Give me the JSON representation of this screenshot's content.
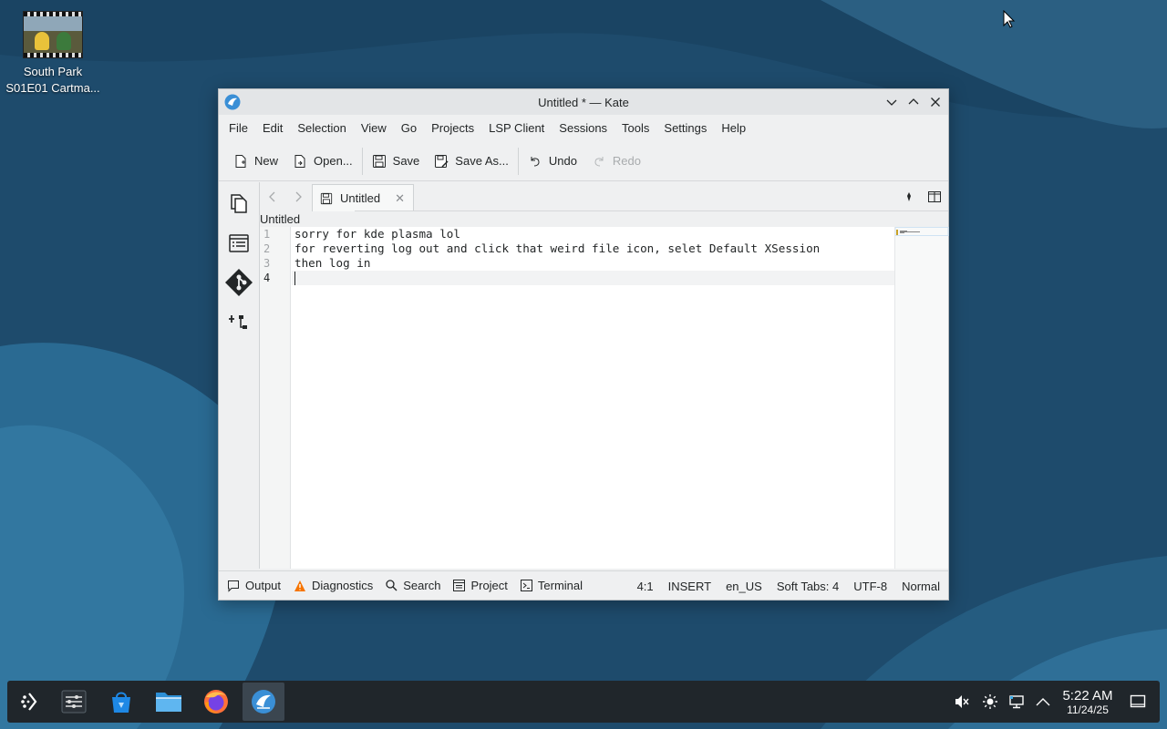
{
  "desktop": {
    "icon_label_line1": "South Park",
    "icon_label_line2": "S01E01 Cartma..."
  },
  "window": {
    "title": "Untitled * — Kate",
    "menu": [
      "File",
      "Edit",
      "Selection",
      "View",
      "Go",
      "Projects",
      "LSP Client",
      "Sessions",
      "Tools",
      "Settings",
      "Help"
    ],
    "toolbar": {
      "new": "New",
      "open": "Open...",
      "save": "Save",
      "save_as": "Save As...",
      "undo": "Undo",
      "redo": "Redo"
    },
    "tab": {
      "label": "Untitled"
    },
    "breadcrumb": "Untitled",
    "editor": {
      "lines": [
        "sorry for kde plasma lol",
        "for reverting log out and click that weird file icon, selet Default XSession",
        "then log in",
        ""
      ],
      "line_numbers": [
        "1",
        "2",
        "3",
        "4"
      ]
    },
    "statusbar": {
      "output": "Output",
      "diagnostics": "Diagnostics",
      "search": "Search",
      "project": "Project",
      "terminal": "Terminal",
      "cursor_pos": "4:1",
      "mode": "INSERT",
      "language": "en_US",
      "indent": "Soft Tabs: 4",
      "encoding": "UTF-8",
      "input_mode": "Normal"
    }
  },
  "taskbar": {
    "clock_time": "5:22 AM",
    "clock_date": "11/24/25"
  },
  "colors": {
    "desktop": "#1d4a6a",
    "taskbar": "#20262b",
    "accent": "#3daee9",
    "warning": "#f67400"
  }
}
